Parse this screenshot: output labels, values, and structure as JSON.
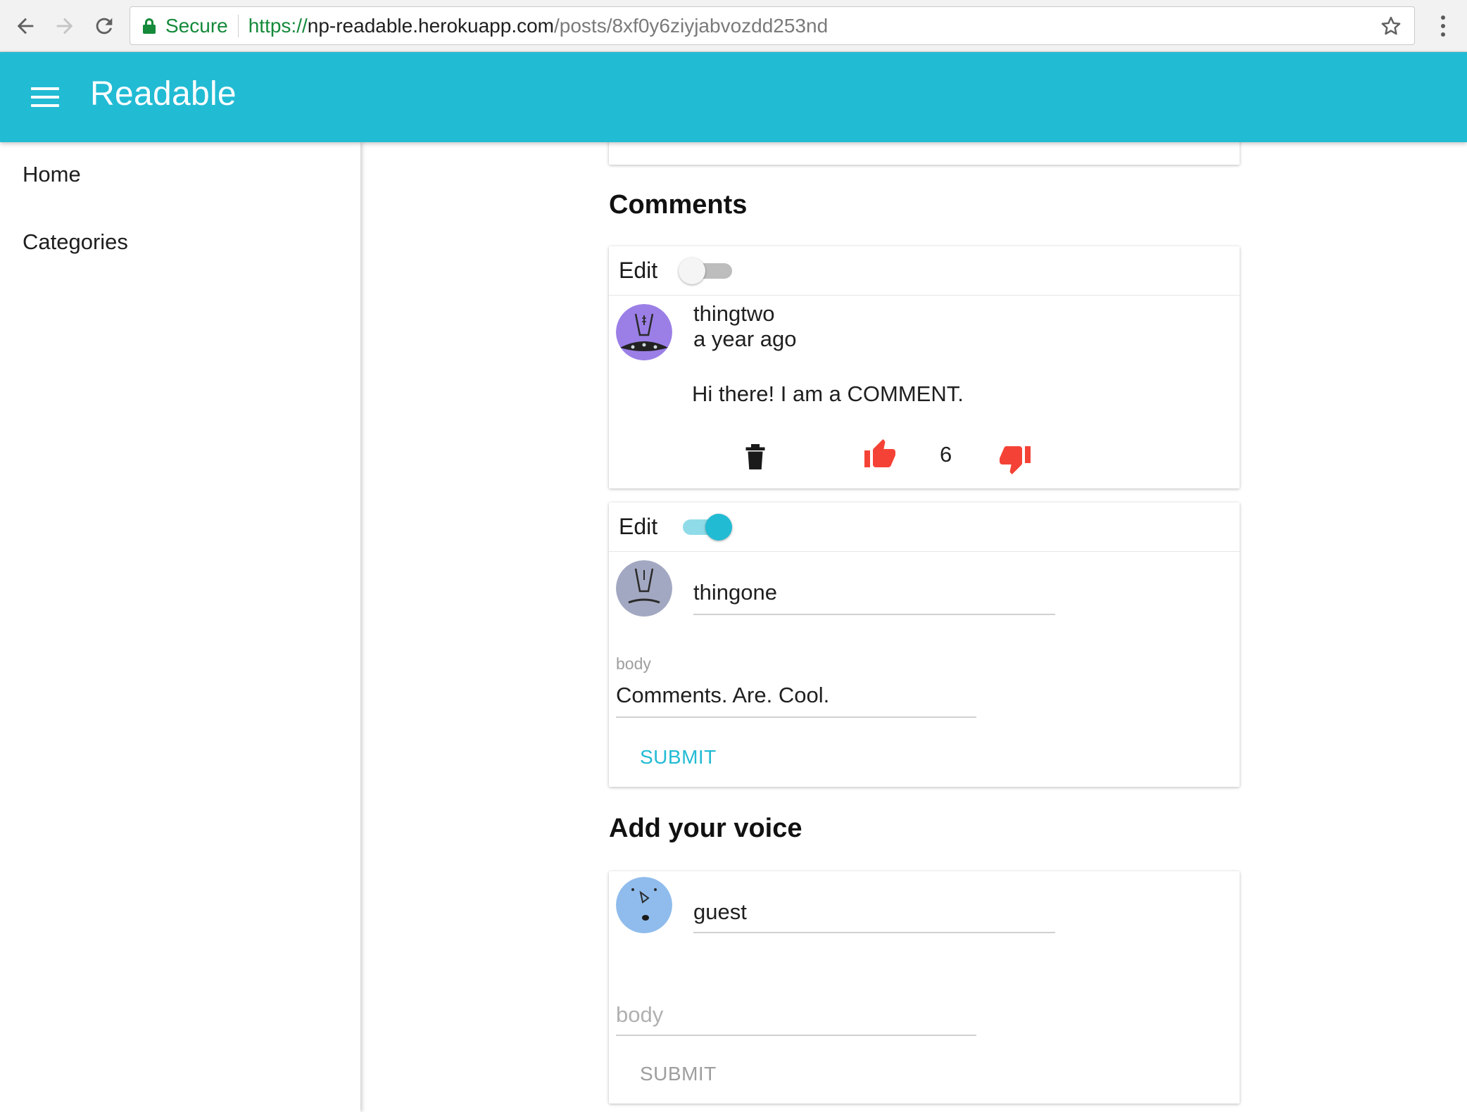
{
  "browser": {
    "secure_label": "Secure",
    "url_scheme": "https://",
    "url_host": "np-readable.herokuapp.com",
    "url_path": "/posts/8xf0y6ziyjabvozdd253nd"
  },
  "appbar": {
    "title": "Readable"
  },
  "drawer": {
    "items": [
      {
        "label": "Home"
      },
      {
        "label": "Categories"
      }
    ]
  },
  "comments_section": {
    "title": "Comments",
    "comments": [
      {
        "edit_label": "Edit",
        "edit_enabled": false,
        "author": "thingtwo",
        "time": "a year ago",
        "body": "Hi there! I am a COMMENT.",
        "vote_score": "6",
        "avatar_color": "#9b7fe6"
      },
      {
        "edit_label": "Edit",
        "edit_enabled": true,
        "author_value": "thingone",
        "body_label": "body",
        "body_value": "Comments. Are. Cool.",
        "submit_label": "SUBMIT",
        "avatar_color": "#a3a8c2"
      }
    ]
  },
  "add_voice": {
    "title": "Add your voice",
    "author_value": "guest",
    "body_placeholder": "body",
    "submit_label": "SUBMIT",
    "avatar_color": "#8fbcec"
  },
  "colors": {
    "primary": "#22bbd4",
    "vote_red": "#f44336",
    "secure_green": "#148a3a"
  }
}
